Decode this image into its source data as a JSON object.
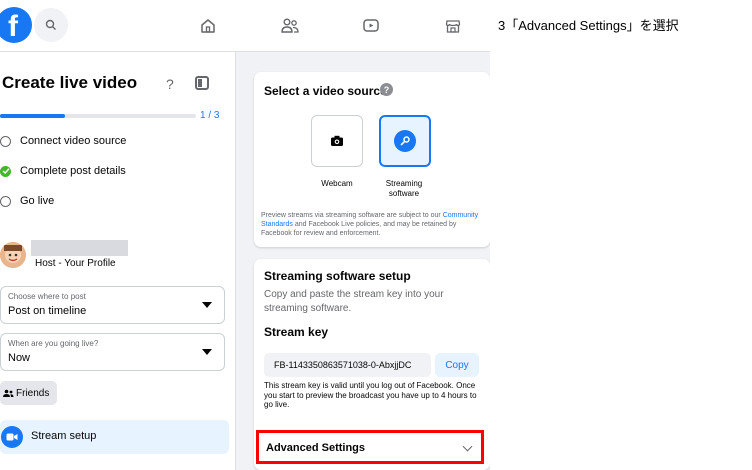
{
  "caption": "3「Advanced Settings」を選択",
  "nav": {
    "logo": "f",
    "icons": [
      "home-icon",
      "friends-icon",
      "watch-icon",
      "marketplace-icon"
    ]
  },
  "left_panel": {
    "title": "Create live video",
    "help": "?",
    "progress": {
      "current": 1,
      "total": 3,
      "fraction": 0.33,
      "label": "1 / 3"
    },
    "steps": [
      {
        "label": "Connect video source",
        "done": false
      },
      {
        "label": "Complete post details",
        "done": true
      },
      {
        "label": "Go live",
        "done": false
      }
    ],
    "host_label": "Host - Your Profile",
    "post_where": {
      "label": "Choose where to post",
      "value": "Post on timeline"
    },
    "go_live_when": {
      "label": "When are you going live?",
      "value": "Now"
    },
    "audience_button": "Friends",
    "stream_setup": "Stream setup"
  },
  "video_source": {
    "heading": "Select a video source",
    "options": [
      {
        "label": "Webcam",
        "selected": false
      },
      {
        "label": "Streaming software",
        "selected": true
      }
    ],
    "notice_pre": "Preview streams via streaming software are subject to our ",
    "notice_link": "Community Standards",
    "notice_post": " and Facebook Live policies, and may be retained by Facebook for review and enforcement."
  },
  "software_setup": {
    "heading": "Streaming software setup",
    "description": "Copy and paste the stream key into your streaming software.",
    "stream_key_label": "Stream key",
    "stream_key_value": "FB-1143350863571038-0-AbxjjDC",
    "copy_label": "Copy",
    "validity_note": "This stream key is valid until you log out of Facebook. Once you start to preview the broadcast you have up to 4 hours to go live.",
    "advanced_settings": "Advanced Settings"
  },
  "colors": {
    "accent": "#1877f2",
    "highlight": "#ff0000",
    "success": "#42b72a"
  }
}
